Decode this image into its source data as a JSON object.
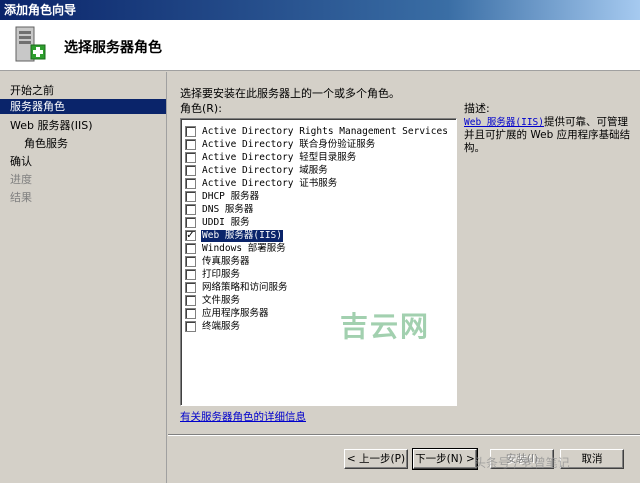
{
  "window": {
    "title": "添加角色向导"
  },
  "header": {
    "title": "选择服务器角色"
  },
  "sidebar": {
    "items": [
      {
        "label": "开始之前",
        "state": "normal"
      },
      {
        "label": "服务器角色",
        "state": "active"
      },
      {
        "label": "Web 服务器(IIS)",
        "state": "normal"
      },
      {
        "label": "角色服务",
        "state": "sub"
      },
      {
        "label": "确认",
        "state": "normal"
      },
      {
        "label": "进度",
        "state": "disabled"
      },
      {
        "label": "结果",
        "state": "disabled"
      }
    ]
  },
  "main": {
    "instruction": "选择要安装在此服务器上的一个或多个角色。",
    "roles_label": "角色(R):",
    "roles": [
      {
        "label": "Active Directory Rights Management Services",
        "checked": false
      },
      {
        "label": "Active Directory 联合身份验证服务",
        "checked": false
      },
      {
        "label": "Active Directory 轻型目录服务",
        "checked": false
      },
      {
        "label": "Active Directory 域服务",
        "checked": false
      },
      {
        "label": "Active Directory 证书服务",
        "checked": false
      },
      {
        "label": "DHCP 服务器",
        "checked": false
      },
      {
        "label": "DNS 服务器",
        "checked": false
      },
      {
        "label": "UDDI 服务",
        "checked": false
      },
      {
        "label": "Web 服务器(IIS)",
        "checked": true,
        "selected": true
      },
      {
        "label": "Windows 部署服务",
        "checked": false
      },
      {
        "label": "传真服务器",
        "checked": false
      },
      {
        "label": "打印服务",
        "checked": false
      },
      {
        "label": "网络策略和访问服务",
        "checked": false
      },
      {
        "label": "文件服务",
        "checked": false
      },
      {
        "label": "应用程序服务器",
        "checked": false
      },
      {
        "label": "终端服务",
        "checked": false
      }
    ],
    "check_mark": "✓",
    "description_heading": "描述:",
    "description_link": "Web 服务器(IIS)",
    "description_text": "提供可靠、可管理并且可扩展的 Web 应用程序基础结构。",
    "more_info_link": "有关服务器角色的详细信息"
  },
  "buttons": {
    "back": "< 上一步(P)",
    "next": "下一步(N) >",
    "install": "安装(I)",
    "cancel": "取消"
  },
  "watermarks": {
    "center": "吉云网",
    "corner": "头条号 / 老曾笔记"
  },
  "colors": {
    "selection": "#0a246a",
    "link": "#0000cc",
    "face": "#d4d0c8"
  }
}
